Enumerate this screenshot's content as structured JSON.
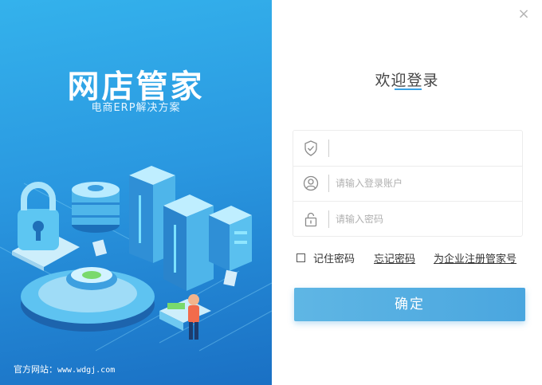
{
  "left_panel": {
    "brand_title": "网店管家",
    "brand_subtitle": "电商ERP解决方案",
    "website_label": "官方网站：",
    "website_url": "www.wdgj.com"
  },
  "window": {
    "close_glyph": "×"
  },
  "login": {
    "welcome_title": "欢迎登录",
    "company_field": {
      "value": "",
      "placeholder": "",
      "icon": "shield-icon"
    },
    "account_field": {
      "value": "",
      "placeholder": "请输入登录账户",
      "icon": "user-icon"
    },
    "password_field": {
      "value": "",
      "placeholder": "请输入密码",
      "icon": "lock-icon"
    },
    "remember_label": "记住密码",
    "remember_checked": false,
    "forgot_label": "忘记密码",
    "register_label": "为企业注册管家号",
    "confirm_label": "确定"
  },
  "colors": {
    "accent": "#3aa2e4",
    "button": "#55aee2",
    "left_top": "#34b2ec",
    "left_bottom": "#1a70c4"
  }
}
